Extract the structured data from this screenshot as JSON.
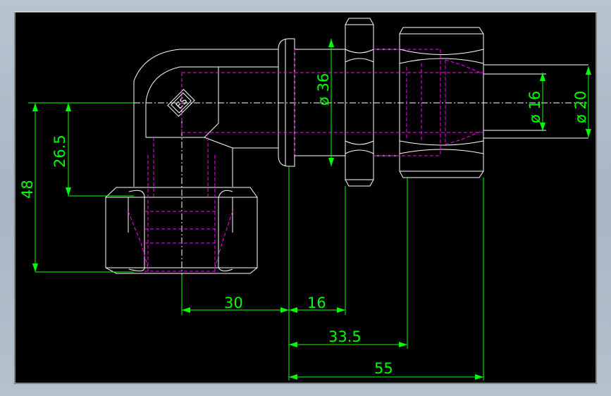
{
  "dimensions": {
    "dia_36": "ø 36",
    "dia_16": "ø 16",
    "dia_20": "ø 20",
    "height_26_5": "26.5",
    "height_48": "48",
    "len_30": "30",
    "len_16": "16",
    "len_33_5": "33.5",
    "len_55": "55"
  },
  "marking": "ES",
  "colors": {
    "background": "#000000",
    "geometry": "#ffffff",
    "hidden_lines": "#ff00ff",
    "dimensions": "#00ff00"
  }
}
